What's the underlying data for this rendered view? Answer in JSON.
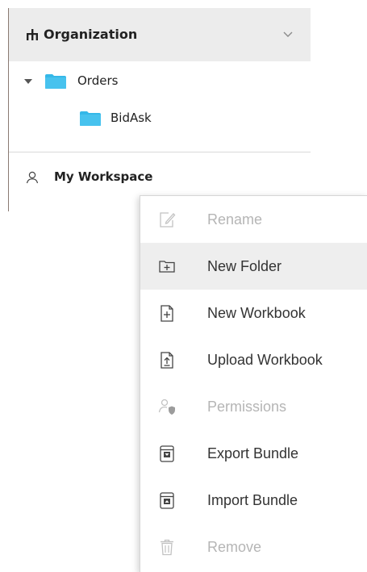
{
  "tree": {
    "header": {
      "title": "Organization",
      "icon": "org-hierarchy-icon",
      "chevron_icon": "chevron-down-icon"
    },
    "nodes": [
      {
        "label": "Orders",
        "expanded": true,
        "icon": "folder-icon"
      },
      {
        "label": "BidAsk",
        "icon": "folder-icon"
      }
    ],
    "workspace": {
      "label": "My Workspace",
      "icon": "user-icon"
    }
  },
  "context_menu": {
    "items": [
      {
        "label": "Rename",
        "icon": "rename-icon",
        "enabled": false
      },
      {
        "label": "New Folder",
        "icon": "new-folder-icon",
        "enabled": true,
        "hovered": true
      },
      {
        "label": "New Workbook",
        "icon": "new-workbook-icon",
        "enabled": true
      },
      {
        "label": "Upload Workbook",
        "icon": "upload-workbook-icon",
        "enabled": true
      },
      {
        "label": "Permissions",
        "icon": "permissions-icon",
        "enabled": false
      },
      {
        "label": "Export Bundle",
        "icon": "export-bundle-icon",
        "enabled": true
      },
      {
        "label": "Import Bundle",
        "icon": "import-bundle-icon",
        "enabled": true
      },
      {
        "label": "Remove",
        "icon": "remove-icon",
        "enabled": false
      }
    ]
  },
  "colors": {
    "folder": "#35b8e8",
    "header_bg": "#ececec",
    "hover_bg": "#eeeeee",
    "disabled_text": "#b5b5b5",
    "text": "#333333"
  }
}
